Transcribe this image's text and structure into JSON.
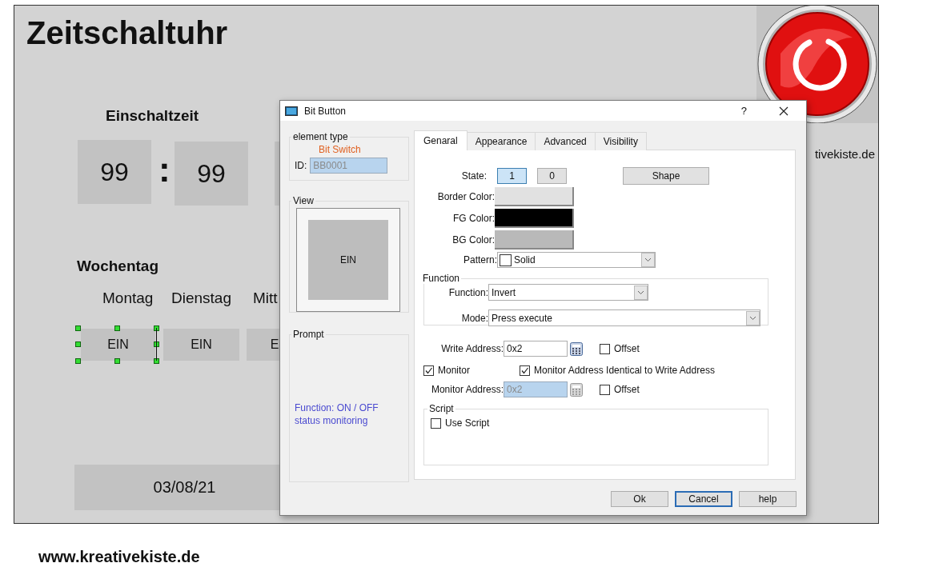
{
  "canvas": {
    "title": "Zeitschaltuhr",
    "time_heading": "Einschaltzeit",
    "time_fields": [
      "99",
      "99"
    ],
    "time_separator": ":",
    "weekday_heading": "Wochentag",
    "weekdays": [
      {
        "label": "Montag"
      },
      {
        "label": "Dienstag"
      },
      {
        "label": "Mitt"
      }
    ],
    "weekday_buttons": [
      {
        "label": "EIN",
        "selected": true
      },
      {
        "label": "EIN",
        "selected": false
      },
      {
        "label": "E",
        "selected": false
      }
    ],
    "date": "03/08/21",
    "side_text": "tivekiste.de"
  },
  "footer": "www.kreativekiste.de",
  "dialog": {
    "title": "Bit Button",
    "help_button": "?",
    "element_type": {
      "legend": "element type",
      "type_name": "Bit Switch",
      "id_label": "ID:",
      "id_value": "BB0001",
      "id_disabled": true
    },
    "view": {
      "legend": "View",
      "preview_label": "EIN"
    },
    "prompt": {
      "legend": "Prompt",
      "text": "Function: ON / OFF status monitoring"
    },
    "tabs": [
      {
        "label": "Genaral",
        "selected": true
      },
      {
        "label": "Appearance",
        "selected": false
      },
      {
        "label": "Advanced",
        "selected": false
      },
      {
        "label": "Visibility",
        "selected": false
      }
    ],
    "general": {
      "state_label": "State:",
      "states": [
        {
          "label": "1",
          "selected": true
        },
        {
          "label": "0",
          "selected": false
        }
      ],
      "shape_button": "Shape",
      "colors": [
        {
          "label": "Border Color:",
          "color": "#e1e1e1"
        },
        {
          "label": "FG Color:",
          "color": "#000000"
        },
        {
          "label": "BG Color:",
          "color": "#b9b9b9"
        }
      ],
      "pattern": {
        "label": "Pattern:",
        "value": "Solid"
      },
      "function_group": {
        "legend": "Function",
        "function": {
          "label": "Function:",
          "value": "Invert"
        },
        "mode": {
          "label": "Mode:",
          "value": "Press execute"
        }
      },
      "write_address": {
        "label": "Write Address:",
        "value": "0x2",
        "offset": {
          "label": "Offset",
          "checked": false
        }
      },
      "monitor": {
        "label": "Monitor",
        "checked": true
      },
      "identical": {
        "label": "Monitor Address Identical to Write Address",
        "checked": true
      },
      "monitor_address": {
        "label": "Monitor Address:",
        "value": "0x2",
        "disabled": true,
        "offset": {
          "label": "Offset",
          "checked": false
        }
      },
      "script_group": {
        "legend": "Script",
        "use_script": {
          "label": "Use Script",
          "checked": false
        }
      }
    },
    "buttons": [
      {
        "label": "Ok",
        "selected": false
      },
      {
        "label": "Cancel",
        "selected": true
      },
      {
        "label": "help",
        "selected": false
      }
    ]
  }
}
